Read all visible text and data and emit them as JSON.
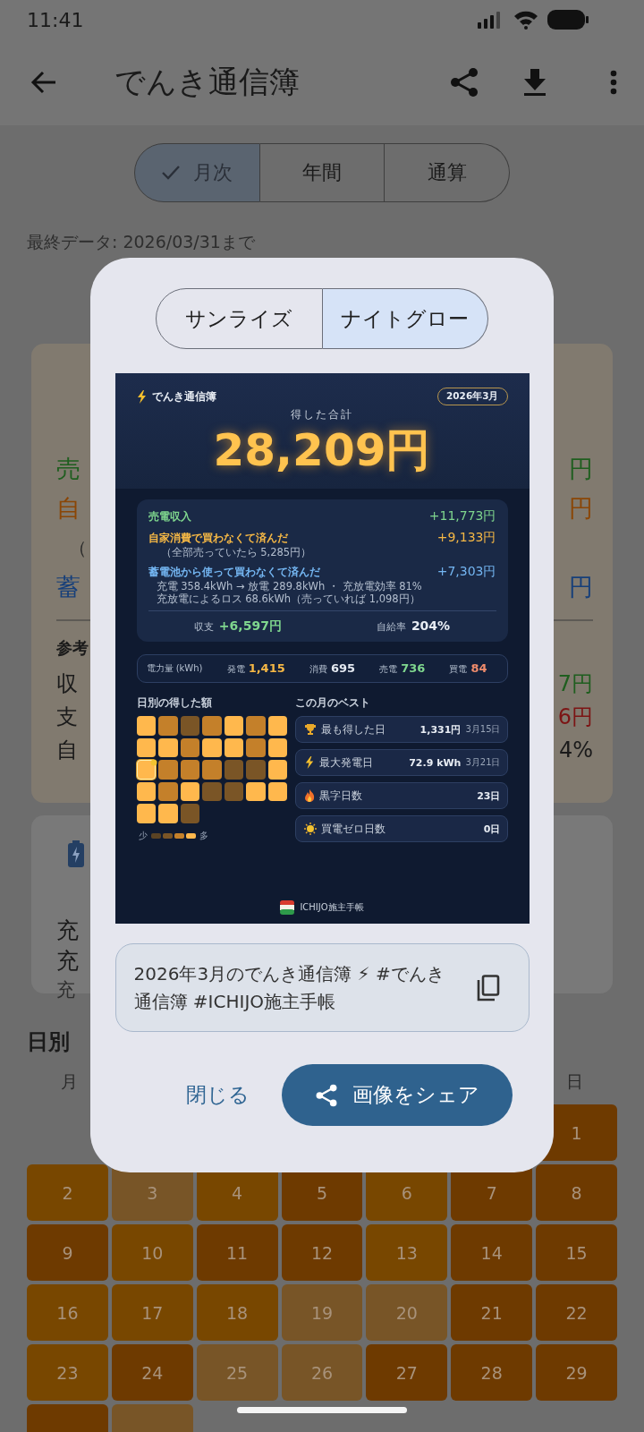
{
  "status_bar": {
    "time": "11:41"
  },
  "app_bar": {
    "title": "でんき通信簿"
  },
  "period_tabs": [
    {
      "label": "月次",
      "selected": true
    },
    {
      "label": "年間",
      "selected": false
    },
    {
      "label": "通算",
      "selected": false
    }
  ],
  "last_data": "最終データ: 2026/03/31まで",
  "summary_card": {
    "rows": [
      {
        "label": "売",
        "value": "円",
        "color": "#1f5e1f"
      },
      {
        "label": "自",
        "value": "円",
        "color": "#8a4606"
      },
      {
        "label": "（"
      },
      {
        "label": "蓄",
        "value": "円",
        "color": "#163f7a"
      }
    ],
    "reference_title": "参考",
    "reference_rows": [
      {
        "label": "収",
        "value": "7円",
        "color": "#1f5e1f"
      },
      {
        "label": "支",
        "value": "6円",
        "color": "#7c1414"
      },
      {
        "label": "自",
        "value": "4%",
        "color": "#1a1a1a"
      }
    ]
  },
  "battery_card": {
    "lines": [
      {
        "text": "充",
        "kind": "main"
      },
      {
        "text": "充",
        "kind": "main"
      },
      {
        "text": "充",
        "kind": "sub"
      }
    ]
  },
  "daily": {
    "title": "日別",
    "weekdays": [
      "月",
      "日"
    ],
    "days": [
      {
        "day": "1",
        "color": "#6e3a00"
      },
      {
        "day": "2",
        "color": "#784700"
      },
      {
        "day": "3",
        "color": "#785527"
      },
      {
        "day": "4",
        "color": "#784700"
      },
      {
        "day": "5",
        "color": "#6e3a00"
      },
      {
        "day": "6",
        "color": "#784700"
      },
      {
        "day": "7",
        "color": "#6e3a00"
      },
      {
        "day": "8",
        "color": "#6e3a00"
      },
      {
        "day": "9",
        "color": "#6e3a00"
      },
      {
        "day": "10",
        "color": "#784700"
      },
      {
        "day": "11",
        "color": "#6e3a00"
      },
      {
        "day": "12",
        "color": "#6e3a00"
      },
      {
        "day": "13",
        "color": "#784700"
      },
      {
        "day": "14",
        "color": "#6e3a00"
      },
      {
        "day": "15",
        "color": "#6e3a00"
      },
      {
        "day": "16",
        "color": "#784700"
      },
      {
        "day": "17",
        "color": "#784700"
      },
      {
        "day": "18",
        "color": "#784700"
      },
      {
        "day": "19",
        "color": "#785527"
      },
      {
        "day": "20",
        "color": "#785527"
      },
      {
        "day": "21",
        "color": "#6e3a00"
      },
      {
        "day": "22",
        "color": "#6e3a00"
      },
      {
        "day": "23",
        "color": "#784700"
      },
      {
        "day": "24",
        "color": "#6e3a00"
      },
      {
        "day": "25",
        "color": "#785527"
      },
      {
        "day": "26",
        "color": "#785527"
      },
      {
        "day": "27",
        "color": "#6e3a00"
      },
      {
        "day": "28",
        "color": "#6e3a00"
      },
      {
        "day": "29",
        "color": "#6e3a00"
      },
      {
        "color": "#6e3a00"
      },
      {
        "color": "#785527"
      }
    ]
  },
  "share_dialog": {
    "themes": [
      {
        "label": "サンライズ",
        "selected": false
      },
      {
        "label": "ナイトグロー",
        "selected": true
      }
    ],
    "card": {
      "brand": "でんき通信簿",
      "month": "2026年3月",
      "total_label": "得した合計",
      "total": "28,209円",
      "breakdown": [
        {
          "label": "売電収入",
          "value": "+11,773円",
          "color": "#7fd68e"
        },
        {
          "label": "自家消費で買わなくて済んだ",
          "value": "+9,133円",
          "color": "#f6b845",
          "notes": [
            "（全部売っていたら 5,285円）"
          ]
        },
        {
          "label": "蓄電池から使って買わなくて済んだ",
          "value": "+7,303円",
          "color": "#74b6f2",
          "notes": [
            "充電 358.4kWh → 放電 289.8kWh ・ 充放電効率 81%",
            "充放電によるロス 68.6kWh（売っていれば 1,098円）"
          ]
        }
      ],
      "balance": {
        "label": "収支",
        "value": "+6,597円"
      },
      "self_sufficiency": {
        "label": "自給率",
        "value": "204%"
      },
      "energy": {
        "label": "電力量 (kWh)",
        "items": [
          {
            "label": "発電",
            "value": "1,415",
            "color": "#f6b845"
          },
          {
            "label": "消費",
            "value": "695",
            "color": "#e3e8f0"
          },
          {
            "label": "売電",
            "value": "736",
            "color": "#7fd68e"
          },
          {
            "label": "買電",
            "value": "84",
            "color": "#f08c6c"
          }
        ]
      },
      "heatmap": {
        "title": "日別の得した額",
        "legend_low": "少",
        "legend_high": "多",
        "legend": [
          {
            "color": "#5a4324"
          },
          {
            "color": "#7a5526"
          },
          {
            "color": "#c4802a"
          },
          {
            "color": "#ffb84d"
          }
        ],
        "cells": [
          {
            "color": "#ffb84d",
            "selected": false
          },
          {
            "color": "#c4802a",
            "selected": false
          },
          {
            "color": "#7a5526",
            "selected": false
          },
          {
            "color": "#c4802a",
            "selected": false
          },
          {
            "color": "#ffb84d",
            "selected": false
          },
          {
            "color": "#c4802a",
            "selected": false
          },
          {
            "color": "#ffb84d",
            "selected": false
          },
          {
            "color": "#ffb84d",
            "selected": false
          },
          {
            "color": "#ffb84d",
            "selected": false
          },
          {
            "color": "#c4802a",
            "selected": false
          },
          {
            "color": "#ffb84d",
            "selected": false
          },
          {
            "color": "#ffb84d",
            "selected": false
          },
          {
            "color": "#c4802a",
            "selected": false
          },
          {
            "color": "#ffb84d",
            "selected": false
          },
          {
            "color": "#ffb84d",
            "selected": true
          },
          {
            "color": "#c4802a",
            "selected": false
          },
          {
            "color": "#c4802a",
            "selected": false
          },
          {
            "color": "#c4802a",
            "selected": false
          },
          {
            "color": "#7a5526",
            "selected": false
          },
          {
            "color": "#7a5526",
            "selected": false
          },
          {
            "color": "#ffb84d",
            "selected": false
          },
          {
            "color": "#ffb84d",
            "selected": false
          },
          {
            "color": "#c4802a",
            "selected": false
          },
          {
            "color": "#ffb84d",
            "selected": false
          },
          {
            "color": "#7a5526",
            "selected": false
          },
          {
            "color": "#7a5526",
            "selected": false
          },
          {
            "color": "#ffb84d",
            "selected": false
          },
          {
            "color": "#ffb84d",
            "selected": false
          },
          {
            "color": "#ffb84d",
            "selected": false
          },
          {
            "color": "#ffb84d",
            "selected": false
          },
          {
            "color": "#7a5526",
            "selected": false
          }
        ]
      },
      "best": {
        "title": "この月のベスト",
        "items": [
          {
            "label": "最も得した日",
            "value": "1,331円",
            "date": "3月15日"
          },
          {
            "label": "最大発電日",
            "value": "72.9 kWh",
            "date": "3月21日"
          },
          {
            "label": "黒字日数",
            "value": "23日"
          },
          {
            "label": "買電ゼロ日数",
            "value": "0日"
          }
        ]
      },
      "footer": "ICHIJO施主手帳"
    },
    "share_text": "2026年3月のでんき通信簿 ⚡ #でんき通信簿 #ICHIJO施主手帳",
    "close_button": "閉じる",
    "share_button": "画像をシェア"
  }
}
